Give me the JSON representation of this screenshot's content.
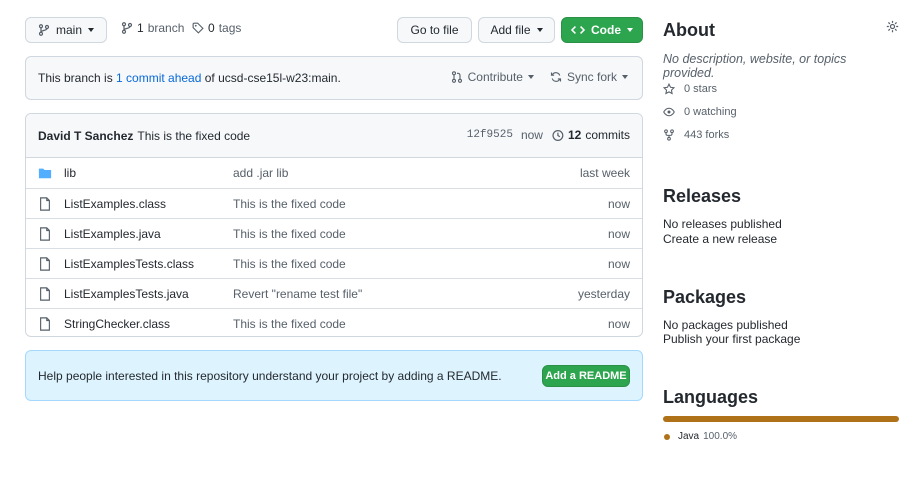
{
  "toolbar": {
    "branch_label": "main",
    "branches_count": "1",
    "branches_label": "branch",
    "tags_count": "0",
    "tags_label": "tags",
    "go_to_file": "Go to file",
    "add_file": "Add file",
    "code": "Code"
  },
  "ahead_bar": {
    "prefix": "This branch is ",
    "link": "1 commit ahead",
    "suffix": " of ucsd-cse15l-w23:main.",
    "contribute": "Contribute",
    "sync_fork": "Sync fork"
  },
  "commit": {
    "author": "David T Sanchez",
    "message": "This is the fixed code",
    "sha": "12f9525",
    "time": "now",
    "commits_count": "12",
    "commits_label": "commits"
  },
  "files": [
    {
      "type": "folder",
      "name": "lib",
      "message": "add .jar lib",
      "age": "last week"
    },
    {
      "type": "file",
      "name": "ListExamples.class",
      "message": "This is the fixed code",
      "age": "now"
    },
    {
      "type": "file",
      "name": "ListExamples.java",
      "message": "This is the fixed code",
      "age": "now"
    },
    {
      "type": "file",
      "name": "ListExamplesTests.class",
      "message": "This is the fixed code",
      "age": "now"
    },
    {
      "type": "file",
      "name": "ListExamplesTests.java",
      "message": "Revert \"rename test file\"",
      "age": "yesterday"
    },
    {
      "type": "file",
      "name": "StringChecker.class",
      "message": "This is the fixed code",
      "age": "now"
    }
  ],
  "readme_banner": {
    "text": "Help people interested in this repository understand your project by adding a README.",
    "button": "Add a README"
  },
  "about": {
    "heading": "About",
    "description": "No description, website, or topics provided.",
    "stars": "0 stars",
    "watching": "0 watching",
    "forks": "443 forks"
  },
  "releases": {
    "heading": "Releases",
    "text": "No releases published",
    "link": "Create a new release"
  },
  "packages": {
    "heading": "Packages",
    "text": "No packages published",
    "link": "Publish your first package"
  },
  "languages": {
    "heading": "Languages",
    "items": [
      {
        "name": "Java",
        "percent": "100.0%",
        "fraction": 1.0,
        "color": "#b07219"
      }
    ]
  },
  "colors": {
    "accent_green": "#2da44e",
    "link_blue": "#0969da",
    "folder_blue": "#54aeff",
    "java": "#b07219"
  },
  "icons": [
    "branch-icon",
    "tag-icon",
    "code-icon",
    "pr-icon",
    "sync-icon",
    "history-icon",
    "folder-icon",
    "file-icon",
    "gear-icon",
    "star-icon",
    "eye-icon",
    "fork-icon"
  ]
}
